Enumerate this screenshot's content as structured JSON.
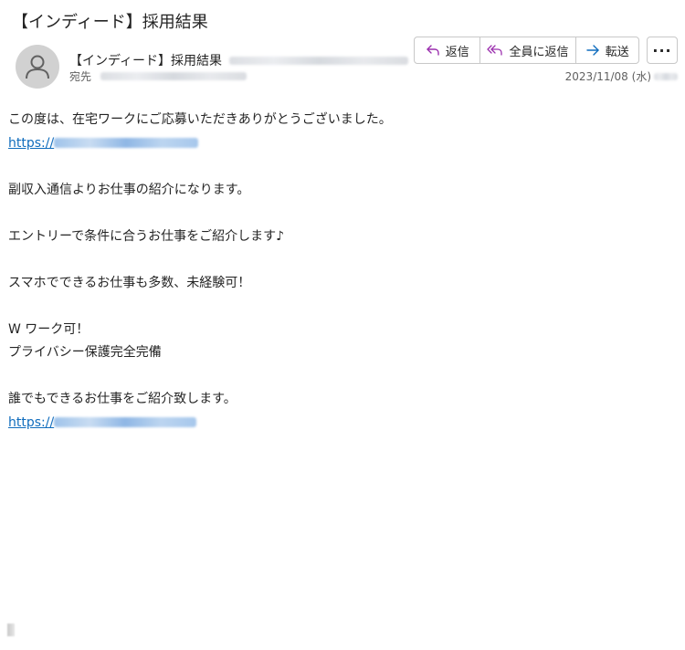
{
  "subject": "【インディード】採用結果",
  "sender": {
    "name": "【インディード】採用結果"
  },
  "recipient": {
    "label": "宛先"
  },
  "actions": {
    "reply": "返信",
    "reply_all": "全員に返信",
    "forward": "転送"
  },
  "date": "2023/11/08 (水)",
  "body": {
    "line1": "この度は、在宅ワークにご応募いただきありがとうございました。",
    "link1_prefix": "https://",
    "line2": "副収入通信よりお仕事の紹介になります。",
    "line3": "エントリーで条件に合うお仕事をご紹介します♪",
    "line4": "スマホでできるお仕事も多数、未経験可！",
    "line5": "W ワーク可！",
    "line6": "プライバシー保護完全完備",
    "line7": "誰でもできるお仕事をご紹介致します。",
    "link2_prefix": "https://"
  },
  "colors": {
    "accent": "#0f6cbd",
    "reply_icon": "#9b2fae",
    "forward_icon": "#0f6cbd"
  },
  "icons": [
    "person-avatar-icon",
    "reply-icon",
    "reply-all-icon",
    "forward-icon",
    "more-icon"
  ]
}
